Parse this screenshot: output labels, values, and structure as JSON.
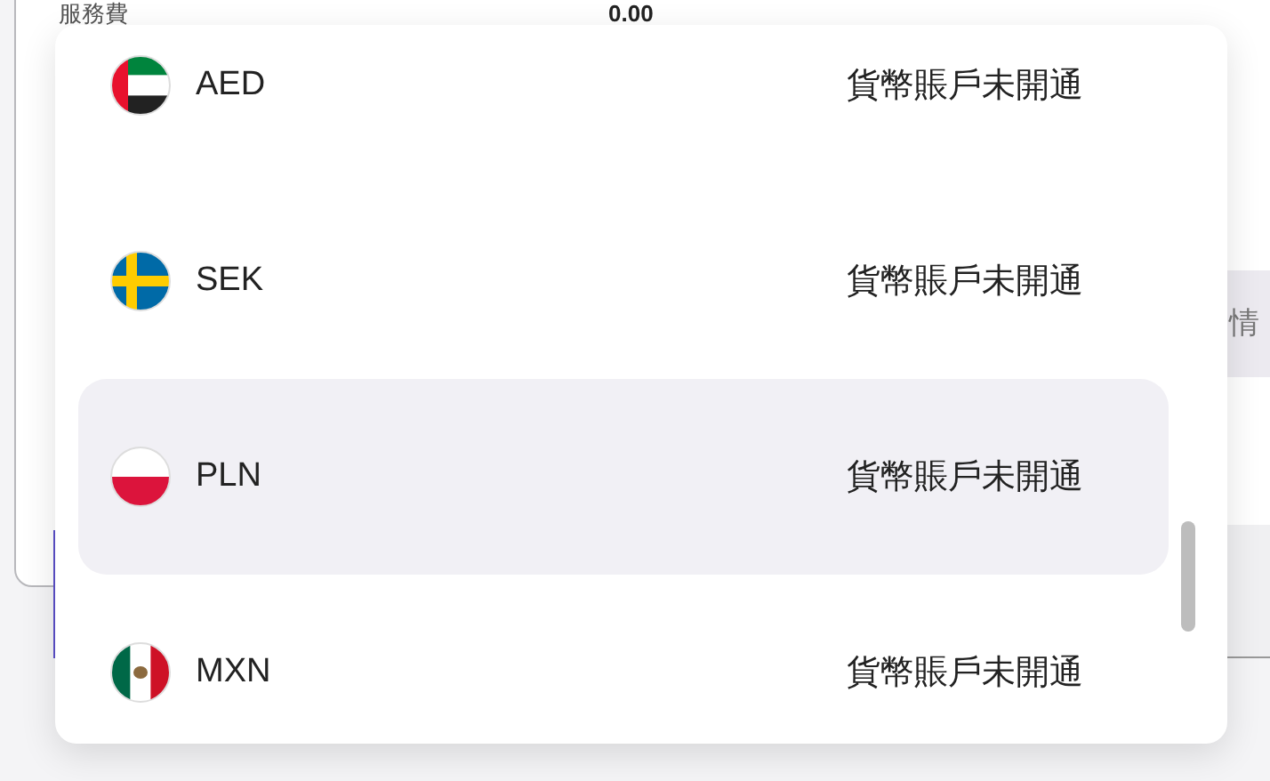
{
  "background": {
    "fee_label": "服務費",
    "fee_value": "0.00",
    "side_text": "情"
  },
  "currency_menu": {
    "items": [
      {
        "code": "AED",
        "kind": "ae",
        "status": "貨幣賬戶未開通",
        "selected": false
      },
      {
        "code": "SEK",
        "kind": "se",
        "status": "貨幣賬戶未開通",
        "selected": false
      },
      {
        "code": "PLN",
        "kind": "pl",
        "status": "貨幣賬戶未開通",
        "selected": true
      },
      {
        "code": "MXN",
        "kind": "mx",
        "status": "貨幣賬戶未開通",
        "selected": false
      }
    ]
  }
}
